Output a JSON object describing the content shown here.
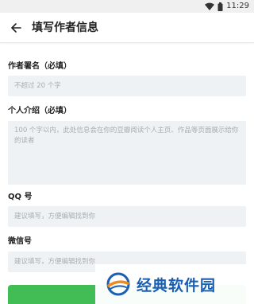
{
  "status_bar": {
    "time": "11:29",
    "icons": [
      "wifi-icon",
      "battery-icon"
    ]
  },
  "app_bar": {
    "back_icon": "arrow-left-icon",
    "title": "填写作者信息"
  },
  "form": {
    "pen_name": {
      "label": "作者署名（必填）",
      "placeholder": "不超过 20 个字"
    },
    "intro": {
      "label": "个人介绍（必填）",
      "placeholder": "100 个字以内，此处信息会在你的豆瓣阅读个人主页、作品等页面展示给你的读者"
    },
    "qq": {
      "label": "QQ 号",
      "placeholder": "建议填写，方便编辑找到你"
    },
    "wechat": {
      "label": "微信号",
      "placeholder": "建议填写，方便编辑找到你"
    }
  },
  "submit_button": {
    "color": "#42bd56"
  },
  "watermark": {
    "text": "经典软件园",
    "logo": "watermark-logo-icon"
  },
  "colors": {
    "field_bg": "#eef2f4",
    "placeholder": "#a8adb0",
    "accent": "#42bd56"
  }
}
